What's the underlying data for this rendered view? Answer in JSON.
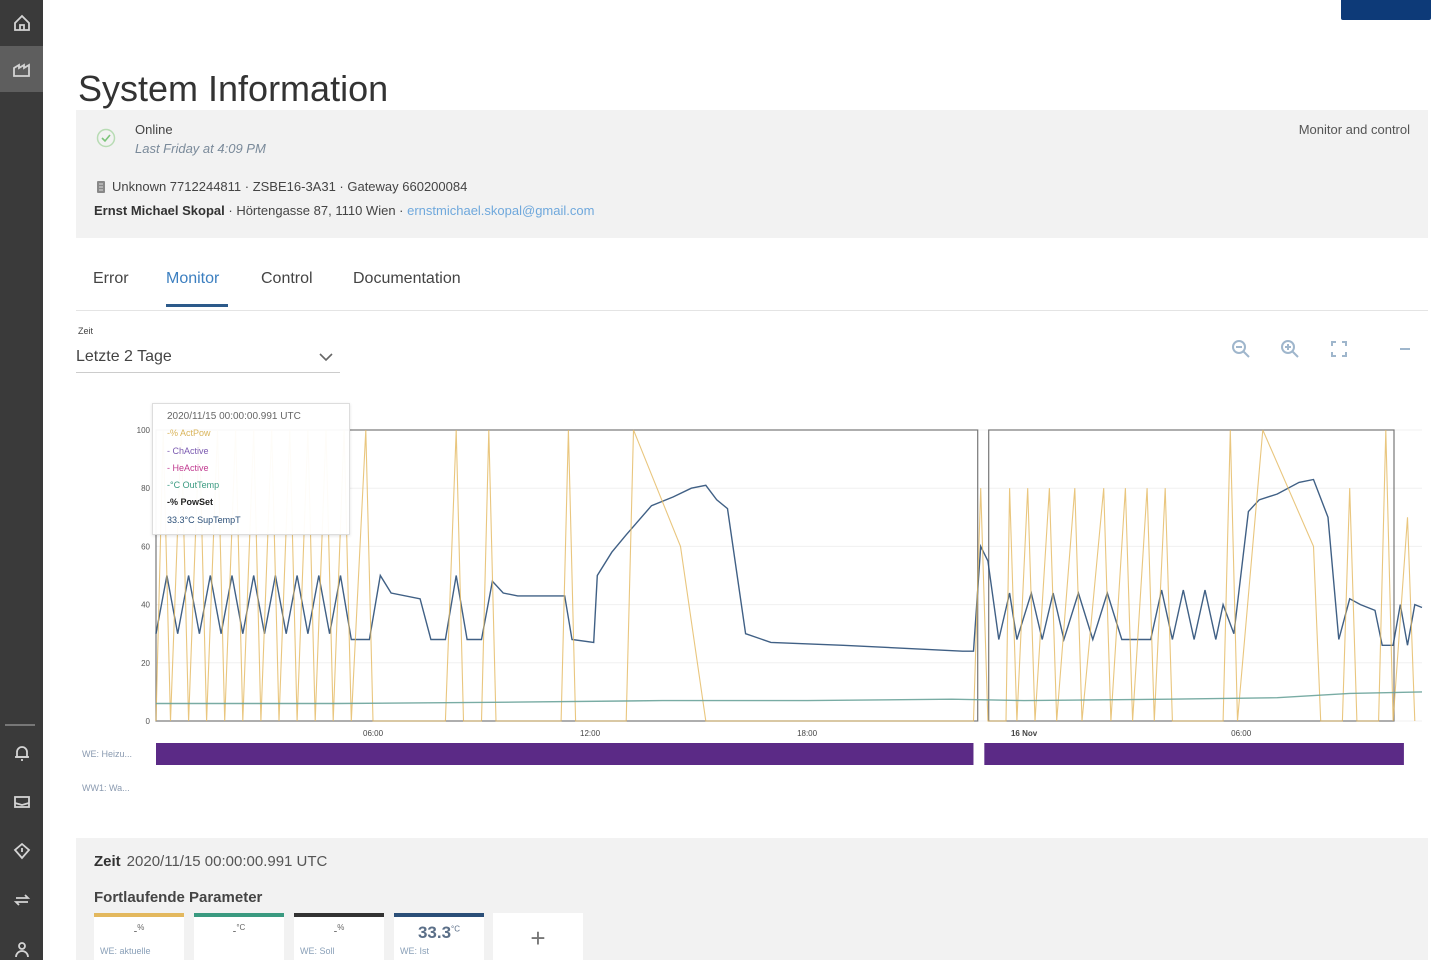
{
  "sidebar": {
    "items": [
      {
        "icon": "home-icon",
        "active": false
      },
      {
        "icon": "factory-icon",
        "active": true
      },
      {
        "icon": "bell-icon",
        "active": false
      },
      {
        "icon": "mail-icon",
        "active": false
      },
      {
        "icon": "info-icon",
        "active": false
      },
      {
        "icon": "transfer-icon",
        "active": false
      },
      {
        "icon": "user-icon",
        "active": false
      }
    ]
  },
  "page": {
    "title": "System Information"
  },
  "info": {
    "status": "Online",
    "last_seen": "Last Friday at 4:09 PM",
    "mode": "Monitor and control",
    "device": "Unknown 7712244811 · ZSBE16-3A31 · Gateway 660200084",
    "owner_name": "Ernst Michael Skopal",
    "owner_address": " · Hörtengasse 87, 1110 Wien · ",
    "owner_email": "ernstmichael.skopal@gmail.com",
    "status_color": "#7cc47a"
  },
  "tabs": [
    {
      "label": "Error",
      "active": false
    },
    {
      "label": "Monitor",
      "active": true
    },
    {
      "label": "Control",
      "active": false
    },
    {
      "label": "Documentation",
      "active": false
    }
  ],
  "time_select": {
    "label": "Zeit",
    "value": "Letzte 2 Tage"
  },
  "chart_tools": [
    {
      "icon": "zoom-out-icon"
    },
    {
      "icon": "zoom-in-icon"
    },
    {
      "icon": "fullscreen-icon"
    },
    {
      "icon": "minimize-icon"
    }
  ],
  "tooltip": {
    "timestamp": "2020/11/15 00:00:00.991 UTC",
    "entries": [
      {
        "label": "-% ActPow",
        "color": "#d9b45a"
      },
      {
        "label": "- ChActive",
        "color": "#7b5ab0"
      },
      {
        "label": "- HeActive",
        "color": "#c0398f"
      },
      {
        "label": "-°C OutTemp",
        "color": "#3a9a80"
      },
      {
        "label": "-% PowSet",
        "color": "#222222"
      },
      {
        "label": "33.3°C SupTempT",
        "color": "#2b4f78"
      }
    ]
  },
  "chart_data": {
    "type": "line",
    "title": "",
    "xlabel": "",
    "ylabel": "",
    "ylim": [
      0,
      100
    ],
    "yticks": [
      "0",
      "20",
      "40",
      "60",
      "80",
      "100"
    ],
    "xticks": [
      {
        "label": "06:00",
        "hour": 6,
        "bold": false
      },
      {
        "label": "12:00",
        "hour": 12,
        "bold": false
      },
      {
        "label": "18:00",
        "hour": 18,
        "bold": false
      },
      {
        "label": "16 Nov",
        "hour": 24,
        "bold": true
      },
      {
        "label": "06:00",
        "hour": 30,
        "bold": false
      }
    ],
    "x_range_hours": [
      0,
      35
    ],
    "gap_hour": 22.8,
    "series": [
      {
        "name": "SupTempT",
        "unit": "°C",
        "color": "#2b4f78",
        "points": [
          [
            0,
            30
          ],
          [
            0.3,
            50
          ],
          [
            0.6,
            30
          ],
          [
            0.9,
            50
          ],
          [
            1.2,
            30
          ],
          [
            1.5,
            50
          ],
          [
            1.8,
            30
          ],
          [
            2.1,
            50
          ],
          [
            2.4,
            30
          ],
          [
            2.7,
            50
          ],
          [
            3.0,
            30
          ],
          [
            3.3,
            50
          ],
          [
            3.6,
            30
          ],
          [
            3.9,
            50
          ],
          [
            4.2,
            30
          ],
          [
            4.5,
            50
          ],
          [
            4.8,
            30
          ],
          [
            5.1,
            50
          ],
          [
            5.4,
            28
          ],
          [
            5.9,
            28
          ],
          [
            6.2,
            50
          ],
          [
            6.5,
            44
          ],
          [
            7.3,
            42
          ],
          [
            7.6,
            28
          ],
          [
            8.0,
            28
          ],
          [
            8.3,
            50
          ],
          [
            8.6,
            28
          ],
          [
            9.0,
            28
          ],
          [
            9.3,
            48
          ],
          [
            9.6,
            44
          ],
          [
            10.0,
            43
          ],
          [
            11.3,
            43
          ],
          [
            11.5,
            28
          ],
          [
            12.1,
            27
          ],
          [
            12.2,
            50
          ],
          [
            12.6,
            58
          ],
          [
            13.0,
            64
          ],
          [
            13.7,
            74
          ],
          [
            14.3,
            77
          ],
          [
            14.8,
            80
          ],
          [
            15.2,
            81
          ],
          [
            15.5,
            76
          ],
          [
            15.8,
            73
          ],
          [
            16.3,
            30
          ],
          [
            17.0,
            27
          ],
          [
            19.0,
            26
          ],
          [
            22.3,
            24
          ],
          [
            22.6,
            24
          ],
          [
            22.8,
            60
          ],
          [
            23.0,
            55
          ],
          [
            23.3,
            28
          ],
          [
            23.6,
            44
          ],
          [
            23.8,
            28
          ],
          [
            24.2,
            44
          ],
          [
            24.5,
            28
          ],
          [
            24.8,
            44
          ],
          [
            25.1,
            28
          ],
          [
            25.5,
            44
          ],
          [
            25.9,
            28
          ],
          [
            26.3,
            44
          ],
          [
            26.7,
            28
          ],
          [
            27.5,
            28
          ],
          [
            27.8,
            45
          ],
          [
            28.1,
            28
          ],
          [
            28.4,
            45
          ],
          [
            28.7,
            28
          ],
          [
            29.0,
            45
          ],
          [
            29.3,
            28
          ],
          [
            29.5,
            40
          ],
          [
            29.8,
            30
          ],
          [
            30.2,
            72
          ],
          [
            30.5,
            76
          ],
          [
            31.0,
            78
          ],
          [
            31.6,
            82
          ],
          [
            32.0,
            83
          ],
          [
            32.4,
            70
          ],
          [
            32.7,
            28
          ],
          [
            33.0,
            42
          ],
          [
            33.3,
            40
          ],
          [
            33.7,
            38
          ],
          [
            33.9,
            26
          ],
          [
            34.2,
            26
          ],
          [
            34.4,
            40
          ],
          [
            34.6,
            26
          ],
          [
            34.8,
            40
          ],
          [
            35,
            39
          ]
        ]
      },
      {
        "name": "ActPow",
        "unit": "%",
        "color": "#e3b85e",
        "points": [
          [
            0,
            0
          ],
          [
            0.2,
            100
          ],
          [
            0.4,
            0
          ],
          [
            0.7,
            100
          ],
          [
            0.9,
            0
          ],
          [
            1.2,
            100
          ],
          [
            1.4,
            0
          ],
          [
            1.7,
            100
          ],
          [
            1.9,
            0
          ],
          [
            2.2,
            100
          ],
          [
            2.4,
            0
          ],
          [
            2.7,
            100
          ],
          [
            2.9,
            0
          ],
          [
            3.2,
            100
          ],
          [
            3.4,
            0
          ],
          [
            3.7,
            100
          ],
          [
            3.9,
            0
          ],
          [
            4.2,
            100
          ],
          [
            4.4,
            0
          ],
          [
            4.7,
            100
          ],
          [
            4.9,
            0
          ],
          [
            5.2,
            100
          ],
          [
            5.4,
            0
          ],
          [
            5.8,
            100
          ],
          [
            6.0,
            0
          ],
          [
            8.0,
            0
          ],
          [
            8.3,
            100
          ],
          [
            8.5,
            0
          ],
          [
            9.0,
            0
          ],
          [
            9.2,
            100
          ],
          [
            9.4,
            0
          ],
          [
            11.2,
            0
          ],
          [
            11.4,
            100
          ],
          [
            11.6,
            0
          ],
          [
            13.0,
            0
          ],
          [
            13.2,
            100
          ],
          [
            14.5,
            60
          ],
          [
            15.2,
            0
          ],
          [
            22.6,
            0
          ],
          [
            22.8,
            80
          ],
          [
            23.0,
            0
          ],
          [
            23.5,
            0
          ],
          [
            23.6,
            80
          ],
          [
            23.8,
            0
          ],
          [
            24.1,
            80
          ],
          [
            24.3,
            0
          ],
          [
            24.7,
            80
          ],
          [
            24.9,
            0
          ],
          [
            25.4,
            80
          ],
          [
            25.6,
            0
          ],
          [
            26.2,
            80
          ],
          [
            26.4,
            0
          ],
          [
            26.8,
            80
          ],
          [
            27.0,
            0
          ],
          [
            27.4,
            80
          ],
          [
            27.6,
            0
          ],
          [
            27.9,
            80
          ],
          [
            28.1,
            0
          ],
          [
            29.5,
            0
          ],
          [
            29.7,
            100
          ],
          [
            29.9,
            0
          ],
          [
            30.6,
            100
          ],
          [
            32.0,
            60
          ],
          [
            32.2,
            0
          ],
          [
            32.8,
            0
          ],
          [
            33.0,
            80
          ],
          [
            33.2,
            0
          ],
          [
            33.8,
            0
          ],
          [
            34.0,
            100
          ],
          [
            34.2,
            0
          ],
          [
            34.6,
            70
          ],
          [
            34.8,
            0
          ]
        ]
      },
      {
        "name": "OutTemp",
        "unit": "°C",
        "color": "#6aa39a",
        "points": [
          [
            0,
            6
          ],
          [
            5,
            6
          ],
          [
            10,
            6.5
          ],
          [
            14,
            7
          ],
          [
            18,
            7
          ],
          [
            22,
            7.5
          ],
          [
            24,
            7
          ],
          [
            28,
            7.5
          ],
          [
            31,
            8
          ],
          [
            33,
            9.5
          ],
          [
            35,
            10
          ]
        ]
      }
    ],
    "gantt": [
      {
        "label": "WE: Heizu...",
        "color": "#5b2a86",
        "segments": [
          [
            0,
            22.6
          ],
          [
            22.9,
            34.5
          ]
        ]
      },
      {
        "label": "WW1: Wa...",
        "color": "#5b2a86",
        "segments": []
      }
    ]
  },
  "lower": {
    "zeit_label": "Zeit",
    "zeit_value": "2020/11/15 00:00:00.991 UTC",
    "params_title": "Fortlaufende Parameter",
    "params": [
      {
        "value": "-",
        "unit": "%",
        "label": "WE: aktuelle",
        "color": "#e3b85e",
        "big": false
      },
      {
        "value": "-",
        "unit": "°C",
        "label": "",
        "color": "#3a9a80",
        "big": false
      },
      {
        "value": "-",
        "unit": "%",
        "label": "WE: Soll",
        "color": "#333333",
        "big": false
      },
      {
        "value": "33.3",
        "unit": "°C",
        "label": "WE: Ist",
        "color": "#2b4f78",
        "big": true
      }
    ],
    "add_label": "+"
  }
}
